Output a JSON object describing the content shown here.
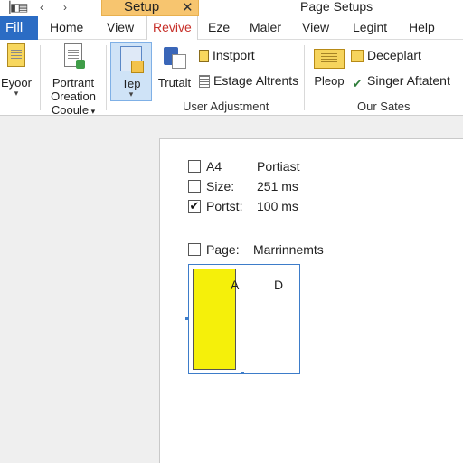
{
  "titlebar": {
    "contextual_tab": "Setup",
    "close_glyph": "✕",
    "document_title": "Page Setups",
    "quick_access": [
      "undo-icon",
      "save-icon",
      "back-icon",
      "forward-icon"
    ]
  },
  "tabs": {
    "file": "Fill",
    "items": [
      "Home",
      "View",
      "Revive",
      "Eze",
      "Maler",
      "View",
      "Legint",
      "Help"
    ],
    "active": "Revive",
    "active_color": "#c7302a",
    "file_color": "#2b6cc4",
    "contextual_color": "#f7c56f"
  },
  "ribbon": {
    "buttons": {
      "eyoor": "Eyoor",
      "portrant_line1": "Portrant",
      "portrant_line2": "Oreation",
      "portrant_line3": "Cooule",
      "tep": "Tep",
      "trutalt": "Trutalt",
      "pleop": "Pleop"
    },
    "small_buttons": {
      "instport": "Instport",
      "estage": "Estage Altrents",
      "deceplart": "Deceplart",
      "singer": "Singer Aftatent"
    },
    "groups": {
      "user_adjustment": "User Adjustment",
      "our_sates": "Our Sates"
    }
  },
  "page_setup": {
    "rows": [
      {
        "checked": false,
        "label": "A4",
        "value": "Portiast"
      },
      {
        "checked": false,
        "label": "Size:",
        "value": "251 ms"
      },
      {
        "checked": true,
        "label": "Portst:",
        "value": "100 ms"
      }
    ],
    "page_row": {
      "checked": false,
      "label": "Page:",
      "value": "Marrinnemts"
    },
    "preview": {
      "label_a": "A",
      "label_d": "D",
      "fill_color": "#f5f00a",
      "border_color": "#3d7cc9"
    }
  }
}
